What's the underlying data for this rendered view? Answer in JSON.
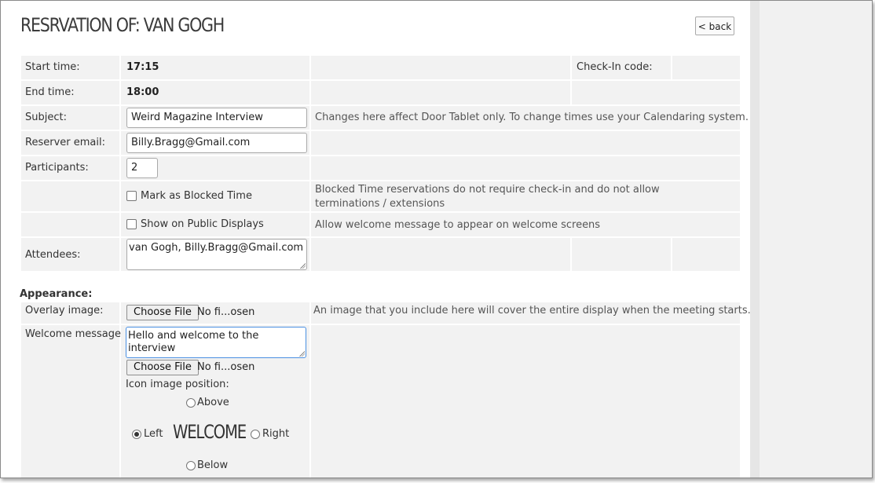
{
  "page": {
    "title": "RESRVATION OF: VAN GOGH",
    "back_label": "< back"
  },
  "reservation": {
    "start_time": {
      "label": "Start time:",
      "value": "17:15"
    },
    "checkin": {
      "label": "Check-In code:"
    },
    "end_time": {
      "label": "End time:",
      "value": "18:00"
    },
    "subject": {
      "label": "Subject:",
      "value": "Weird Magazine Interview",
      "hint": "Changes here affect Door Tablet only.  To change times use your Calendaring system."
    },
    "reserver_email": {
      "label": "Reserver email:",
      "value": "Billy.Bragg@Gmail.com"
    },
    "participants": {
      "label": "Participants:",
      "value": "2"
    },
    "blocked": {
      "label": "Mark as Blocked Time",
      "checked": false,
      "hint": "Blocked Time reservations do not require check-in and do not allow terminations / extensions"
    },
    "public": {
      "label": "Show on Public Displays",
      "checked": false,
      "hint": "Allow welcome message to appear on welcome screens"
    },
    "attendees": {
      "label": "Attendees:",
      "value": "van Gogh, Billy.Bragg@Gmail.com"
    }
  },
  "appearance": {
    "heading": "Appearance:",
    "overlay": {
      "label": "Overlay image:",
      "button": "Choose File",
      "file_text": "No fi...osen",
      "hint": "An image that you include here will cover the entire display when the meeting starts."
    },
    "welcome": {
      "label": "Welcome message:",
      "value": "Hello and welcome to the interview",
      "button": "Choose File",
      "file_text": "No fi...osen",
      "position_label": "Icon image position:",
      "options": {
        "above": "Above",
        "left": "Left",
        "right": "Right",
        "below": "Below"
      },
      "selected": "Left",
      "preview_text": "WELCOME"
    }
  }
}
